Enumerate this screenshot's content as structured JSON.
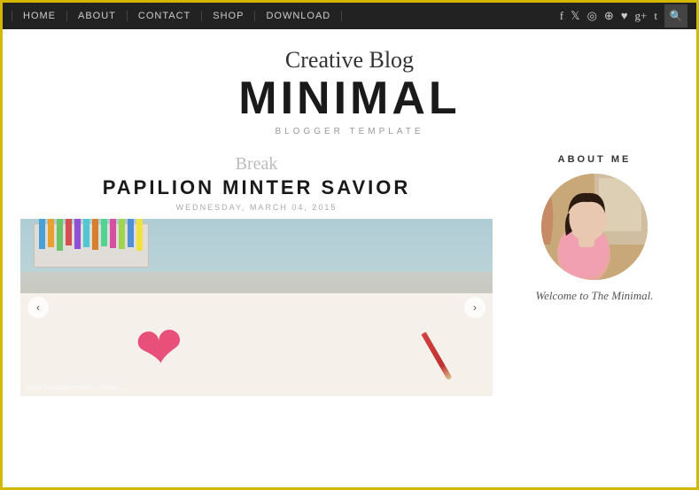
{
  "nav": {
    "links": [
      {
        "label": "HOME",
        "id": "home"
      },
      {
        "label": "ABOUT",
        "id": "about"
      },
      {
        "label": "CONTACT",
        "id": "contact"
      },
      {
        "label": "SHOP",
        "id": "shop"
      },
      {
        "label": "DOWNLOAD",
        "id": "download"
      }
    ],
    "social_icons": [
      "f",
      "t",
      "camera",
      "p",
      "heart",
      "g+",
      "t2"
    ],
    "search_label": "🔍"
  },
  "header": {
    "subtitle": "Creative Blog",
    "title": "MINIMAL",
    "tagline": "BLOGGER TEMPLATE"
  },
  "post": {
    "break_label": "Break",
    "title": "PAPILION MINTER SAVIOR",
    "date": "WEDNESDAY, MARCH 04, 2015"
  },
  "slider": {
    "prev_label": "‹",
    "next_label": "›",
    "watermark": "www.heritagechristiancollege...."
  },
  "sidebar": {
    "about_title": "ABOUT ME",
    "welcome_text": "Welcome to The Minimal."
  }
}
